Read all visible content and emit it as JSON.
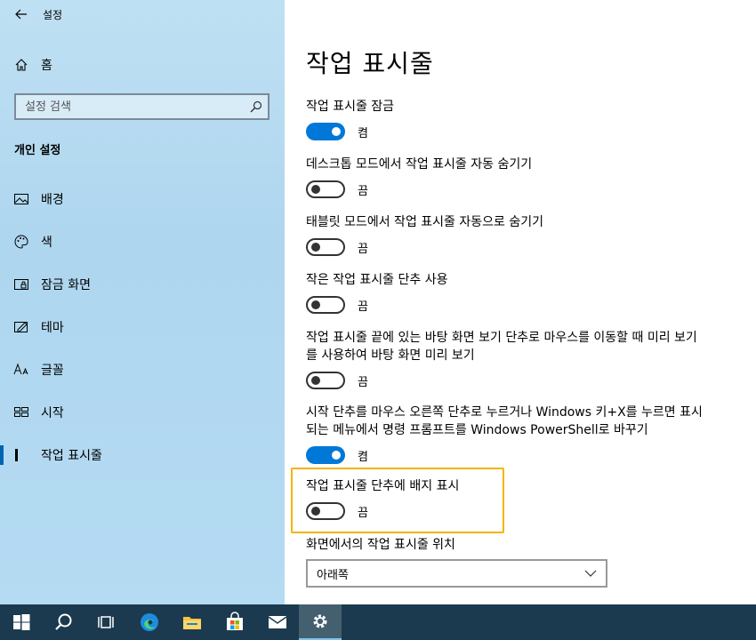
{
  "window": {
    "title": "설정"
  },
  "sidebar": {
    "home_label": "홈",
    "search_placeholder": "설정 검색",
    "section_title": "개인 설정",
    "items": [
      {
        "label": "배경",
        "icon": "image-icon"
      },
      {
        "label": "색",
        "icon": "palette-icon"
      },
      {
        "label": "잠금 화면",
        "icon": "lock-screen-icon"
      },
      {
        "label": "테마",
        "icon": "theme-icon"
      },
      {
        "label": "글꼴",
        "icon": "font-icon"
      },
      {
        "label": "시작",
        "icon": "start-icon"
      },
      {
        "label": "작업 표시줄",
        "icon": "taskbar-icon",
        "active": true
      }
    ]
  },
  "main": {
    "title": "작업 표시줄",
    "settings": [
      {
        "label": "작업 표시줄 잠금",
        "state": "켬",
        "on": true
      },
      {
        "label": "데스크톱 모드에서 작업 표시줄 자동 숨기기",
        "state": "끔",
        "on": false
      },
      {
        "label": "태블릿 모드에서 작업 표시줄 자동으로 숨기기",
        "state": "끔",
        "on": false
      },
      {
        "label": "작은 작업 표시줄 단추 사용",
        "state": "끔",
        "on": false
      },
      {
        "label": "작업 표시줄 끝에 있는 바탕 화면 보기 단추로 마우스를 이동할 때 미리 보기를 사용하여 바탕 화면 미리 보기",
        "state": "끔",
        "on": false
      },
      {
        "label": "시작 단추를 마우스 오른쪽 단추로 누르거나 Windows 키+X를 누르면 표시되는 메뉴에서 명령 프롬프트를 Windows PowerShell로 바꾸기",
        "state": "켬",
        "on": true
      },
      {
        "label": "작업 표시줄 단추에 배지 표시",
        "state": "끔",
        "on": false
      }
    ],
    "position_label": "화면에서의 작업 표시줄 위치",
    "position_value": "아래쪽"
  },
  "colors": {
    "accent": "#0078d7",
    "highlight": "#f4b400",
    "taskbar": "#1b3a4f"
  }
}
